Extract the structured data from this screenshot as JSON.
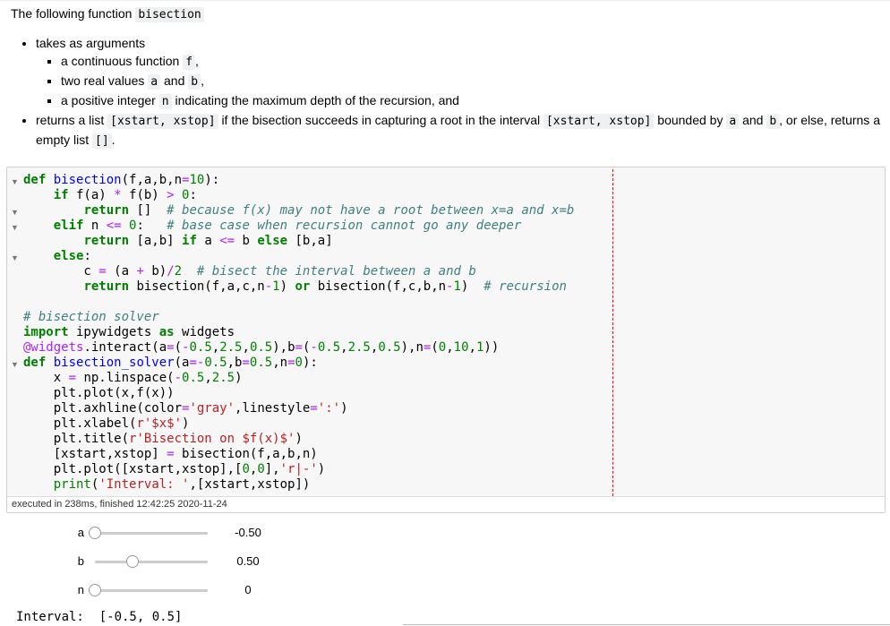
{
  "markdown": {
    "intro": "The following function",
    "fn_name": "bisection",
    "bullet1": "takes as arguments",
    "sub1_pre": "a continuous function",
    "sub1_code": "f",
    "sub1_post": ",",
    "sub2_pre": "two real values",
    "sub2_a": "a",
    "sub2_mid": "and",
    "sub2_b": "b",
    "sub2_post": ",",
    "sub3_pre": "a positive integer",
    "sub3_code": "n",
    "sub3_post": "indicating the maximum depth of the recursion, and",
    "bullet2_pre": "returns a list",
    "bullet2_code1": "[xstart, xstop]",
    "bullet2_mid": "if the bisection succeeds in capturing a root in the interval",
    "bullet2_code2": "[xstart, xstop]",
    "bullet2_mid2": "bounded by",
    "bullet2_a": "a",
    "bullet2_and": "and",
    "bullet2_b": "b",
    "bullet2_end": ", or else, returns a empty list",
    "bullet2_code3": "[]",
    "bullet2_period": "."
  },
  "code_cell": {
    "execution_info": "executed in 238ms, finished 12:42:25 2020-11-24",
    "fold_marker": "▼"
  },
  "widgets": [
    {
      "label": "a",
      "value_text": "-0.50",
      "value": -0.5,
      "min": -0.5,
      "max": 2.5
    },
    {
      "label": "b",
      "value_text": "0.50",
      "value": 0.5,
      "min": -0.5,
      "max": 2.5
    },
    {
      "label": "n",
      "value_text": "0",
      "value": 0,
      "min": 0,
      "max": 10
    }
  ],
  "output": {
    "label": "Interval:",
    "value": "[-0.5, 0.5]"
  }
}
